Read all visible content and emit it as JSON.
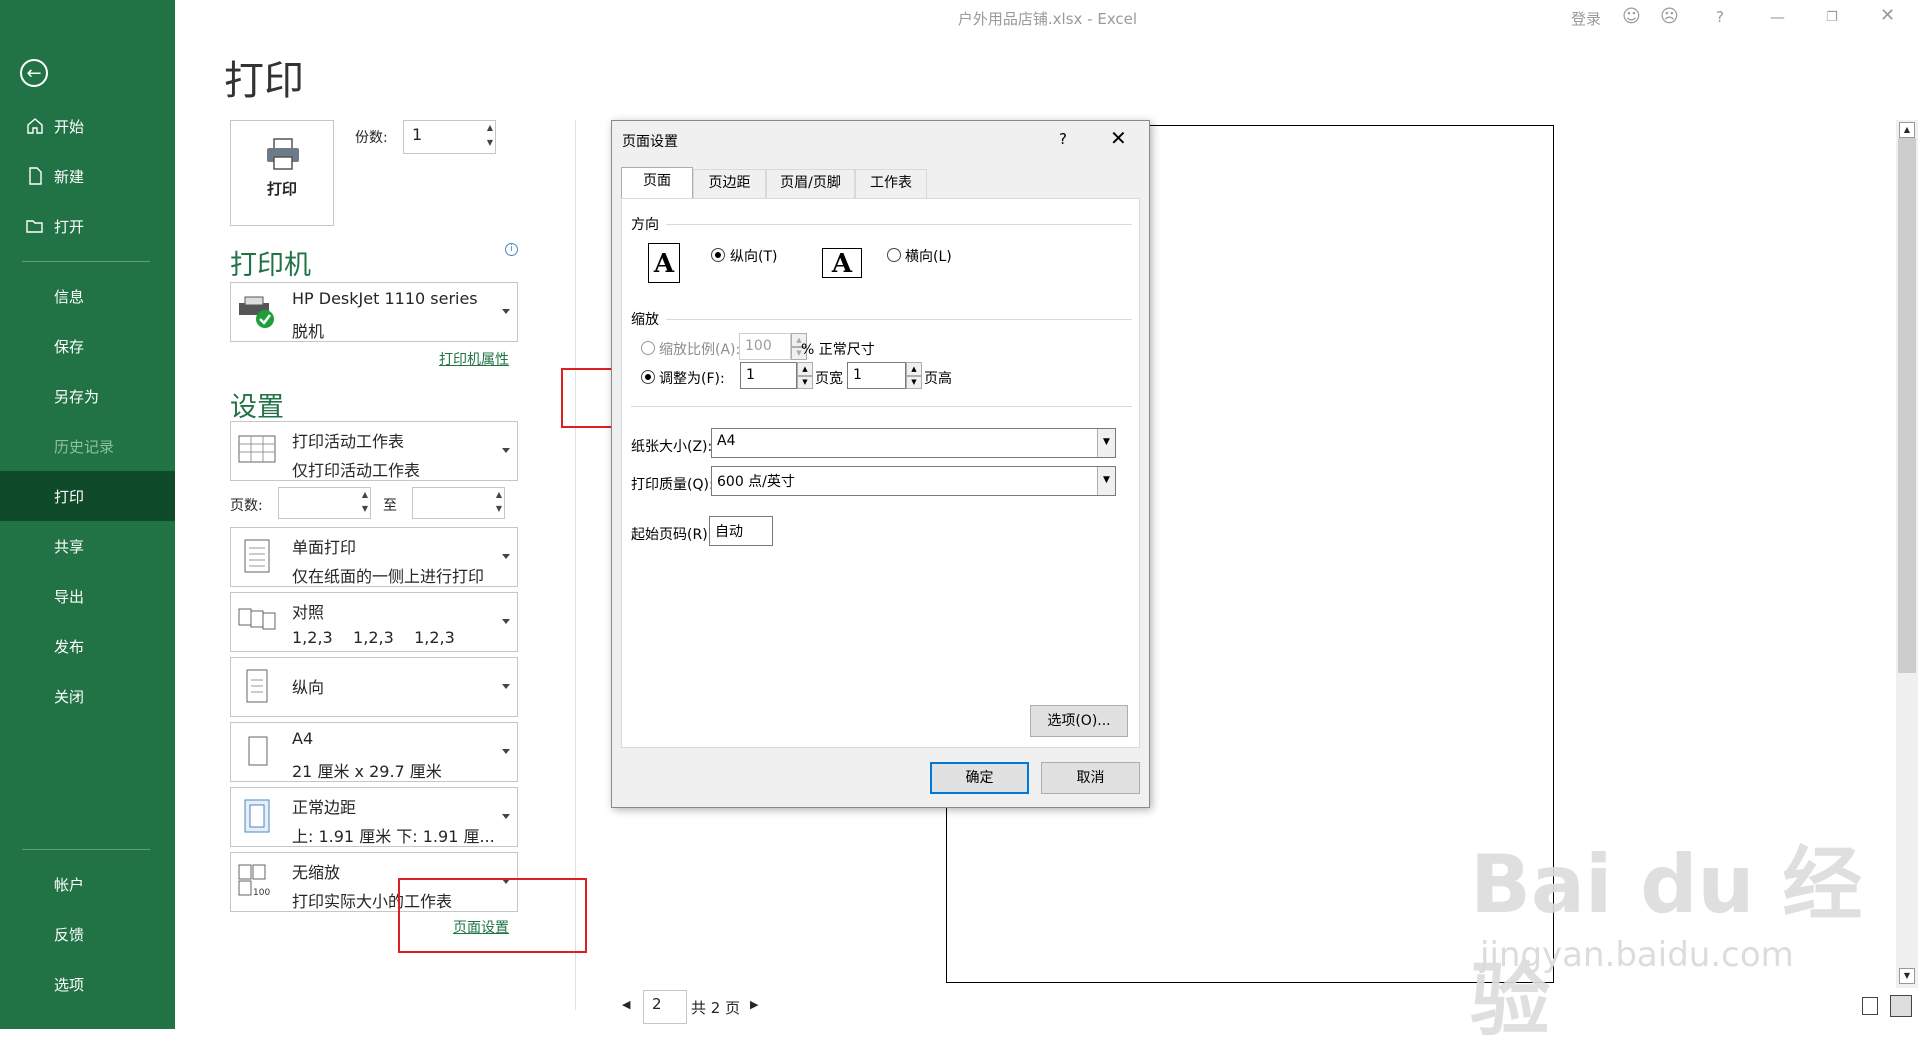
{
  "window": {
    "title": "户外用品店铺.xlsx  -  Excel",
    "signin": "登录"
  },
  "sidebar": {
    "items": [
      "开始",
      "新建",
      "打开",
      "信息",
      "保存",
      "另存为",
      "历史记录",
      "打印",
      "共享",
      "导出",
      "发布",
      "关闭",
      "帐户",
      "反馈",
      "选项"
    ]
  },
  "print": {
    "title": "打印",
    "button_label": "打印",
    "copies_label": "份数:",
    "copies_value": "1",
    "printer_heading": "打印机",
    "printer_name": "HP DeskJet 1110 series",
    "printer_status": "脱机",
    "printer_props": "打印机属性",
    "settings_heading": "设置",
    "pages_label": "页数:",
    "pages_to": "至",
    "settings": [
      {
        "l1": "打印活动工作表",
        "l2": "仅打印活动工作表"
      },
      {
        "l1": "单面打印",
        "l2": "仅在纸面的一侧上进行打印"
      },
      {
        "l1": "对照",
        "l2": "1,2,3    1,2,3    1,2,3"
      },
      {
        "l1": "纵向",
        "l2": ""
      },
      {
        "l1": "A4",
        "l2": "21 厘米 x 29.7 厘米"
      },
      {
        "l1": "正常边距",
        "l2": "上: 1.91 厘米 下: 1.91 厘..."
      },
      {
        "l1": "无缩放",
        "l2": "打印实际大小的工作表"
      }
    ],
    "page_setup_link": "页面设置",
    "current_page": "2",
    "total_pages": "共 2 页"
  },
  "dialog": {
    "title": "页面设置",
    "help": "?",
    "tabs": [
      "页面",
      "页边距",
      "页眉/页脚",
      "工作表"
    ],
    "orientation_label": "方向",
    "portrait": "纵向(T)",
    "landscape": "横向(L)",
    "scaling_label": "缩放",
    "adjust_label": "缩放比例(A):",
    "adjust_value": "100",
    "adjust_suffix": "% 正常尺寸",
    "fit_label": "调整为(F):",
    "fit_wide_value": "1",
    "fit_wide_suffix": "页宽",
    "fit_tall_value": "1",
    "fit_tall_suffix": "页高",
    "paper_size_label": "纸张大小(Z):",
    "paper_size_value": "A4",
    "print_quality_label": "打印质量(Q):",
    "print_quality_value": "600 点/英寸",
    "first_page_label": "起始页码(R):",
    "first_page_value": "自动",
    "options_button": "选项(O)...",
    "ok_button": "确定",
    "cancel_button": "取消"
  },
  "watermark": {
    "brand": "Bai du 经验",
    "url": "jingyan.baidu.com"
  },
  "colors": {
    "accent": "#217346",
    "highlight": "#e02020"
  }
}
